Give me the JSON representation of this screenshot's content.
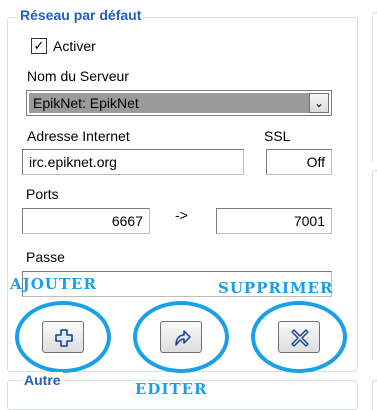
{
  "default_network": {
    "title": "Réseau par défaut",
    "enable_label": "Activer",
    "enable_checked": true,
    "enable_check_glyph": "✓",
    "server_name_label": "Nom du Serveur",
    "server_name_value": "EpikNet: EpikNet",
    "combo_arrow": "⌄",
    "internet_address_label": "Adresse Internet",
    "internet_address_value": "irc.epiknet.org",
    "ssl_label": "SSL",
    "ssl_value": "Off",
    "ports_label": "Ports",
    "port_from": "6667",
    "port_arrow": "->",
    "port_to": "7001",
    "password_label": "Passe",
    "password_value": ""
  },
  "annotations": {
    "add": "AJOUTER",
    "delete": "SUPPRIMER",
    "edit": "EDITER"
  },
  "buttons": {
    "add_icon": "plus-icon",
    "edit_icon": "redo-arrow-icon",
    "delete_icon": "x-icon"
  },
  "other_section": {
    "title": "Autre"
  },
  "colors": {
    "group_title": "#1f5fbf",
    "annotation": "#1aa0e8",
    "selected_combo": "#9b9b9b"
  }
}
